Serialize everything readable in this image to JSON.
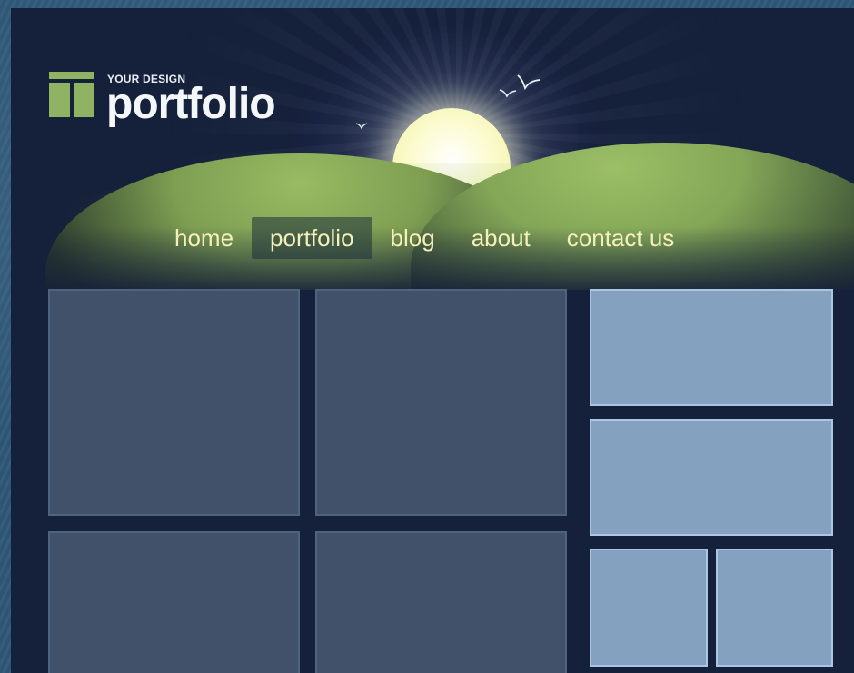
{
  "logo": {
    "tagline": "YOUR DESIGN",
    "title": "portfolio"
  },
  "nav": {
    "items": [
      {
        "label": "home"
      },
      {
        "label": "portfolio",
        "active": true
      },
      {
        "label": "blog"
      },
      {
        "label": "about"
      },
      {
        "label": "contact us"
      }
    ]
  },
  "colors": {
    "accent_green": "#8fb263",
    "nav_text": "#f5f0b8",
    "frame_bg": "#15203a",
    "tile_dark": "#405169",
    "tile_light": "#84a2c0"
  }
}
